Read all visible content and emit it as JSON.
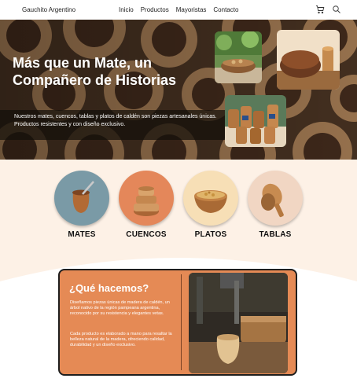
{
  "nav": {
    "brand": "Gauchito Argentino",
    "items": [
      "Inicio",
      "Productos",
      "Mayoristas",
      "Contacto"
    ],
    "icons": [
      "cart-icon",
      "search-icon"
    ]
  },
  "hero": {
    "title": "Más que un Mate, un Compañero de Historias",
    "description": "Nuestros mates, cuencos, tablas y platos de caldén son piezas artesanales únicas. Productos resistentes y con diseño exclusivo."
  },
  "categories": [
    {
      "label": "MATES",
      "bg": "#7a9aa6"
    },
    {
      "label": "CUENCOS",
      "bg": "#e4875a"
    },
    {
      "label": "PLATOS",
      "bg": "#f7dfb6"
    },
    {
      "label": "TABLAS",
      "bg": "#f1d6c3"
    }
  ],
  "about": {
    "title": "¿Qué hacemos?",
    "p1": "Diseñamos piezas únicas de madera de caldén, un árbol nativo de la región pampeana argentina, reconocido por su resistencia y elegantes vetas.",
    "p2": "Cada producto es elaborado a mano para resaltar la belleza natural de la madera, ofreciendo calidad, durabilidad y un diseño exclusivo."
  },
  "colors": {
    "accent": "#e58a55",
    "background": "#fdf1e6"
  }
}
